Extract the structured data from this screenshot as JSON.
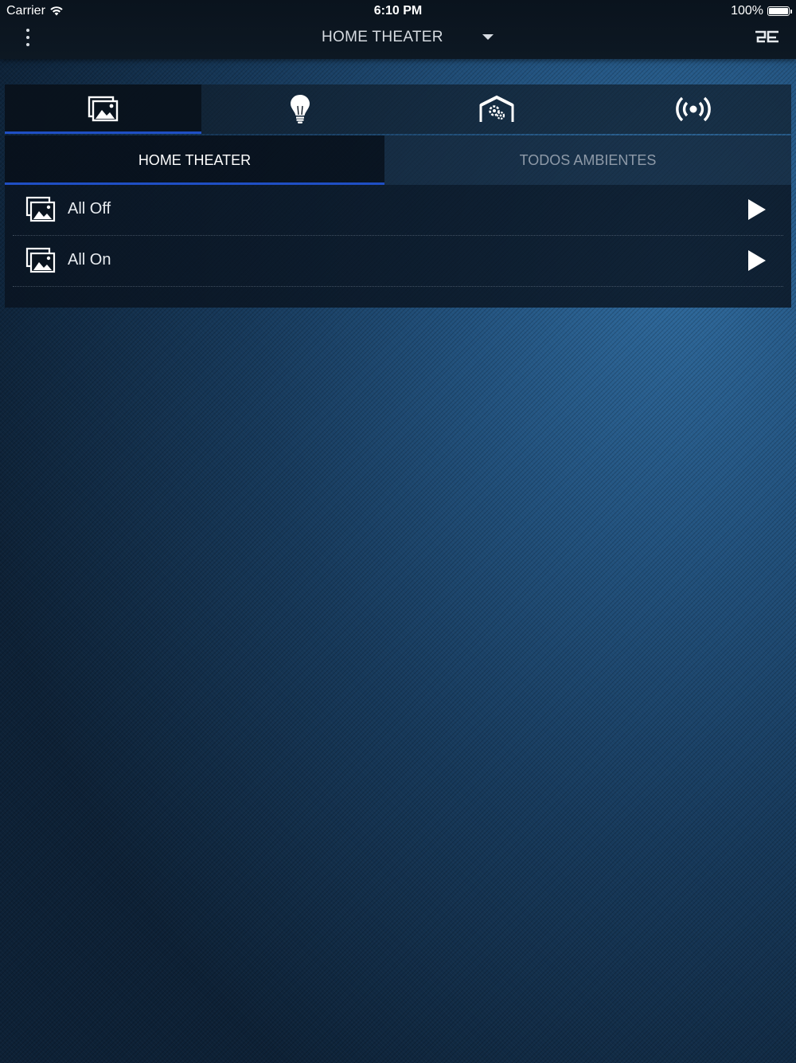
{
  "status_bar": {
    "carrier": "Carrier",
    "time": "6:10 PM",
    "battery_percent": "100%",
    "battery_level": 1.0
  },
  "header": {
    "room_title": "HOME THEATER",
    "menu_icon": "vertical-dots-icon",
    "room_dropdown_icon": "caret-down-icon",
    "logo_icon": "brand-logo-icon"
  },
  "category_tabs": [
    {
      "icon": "scenes-icon",
      "active": true
    },
    {
      "icon": "lightbulb-icon",
      "active": false
    },
    {
      "icon": "garage-gear-icon",
      "active": false
    },
    {
      "icon": "broadcast-icon",
      "active": false
    }
  ],
  "sub_tabs": [
    {
      "label": "HOME THEATER",
      "active": true
    },
    {
      "label": "TODOS AMBIENTES",
      "active": false
    }
  ],
  "scenes": [
    {
      "label": "All Off",
      "icon": "scene-image-icon",
      "action_icon": "play-icon"
    },
    {
      "label": "All On",
      "icon": "scene-image-icon",
      "action_icon": "play-icon"
    }
  ],
  "colors": {
    "accent": "#1f4fc4",
    "background": "#1c4770",
    "topbar": "#0b1520"
  }
}
